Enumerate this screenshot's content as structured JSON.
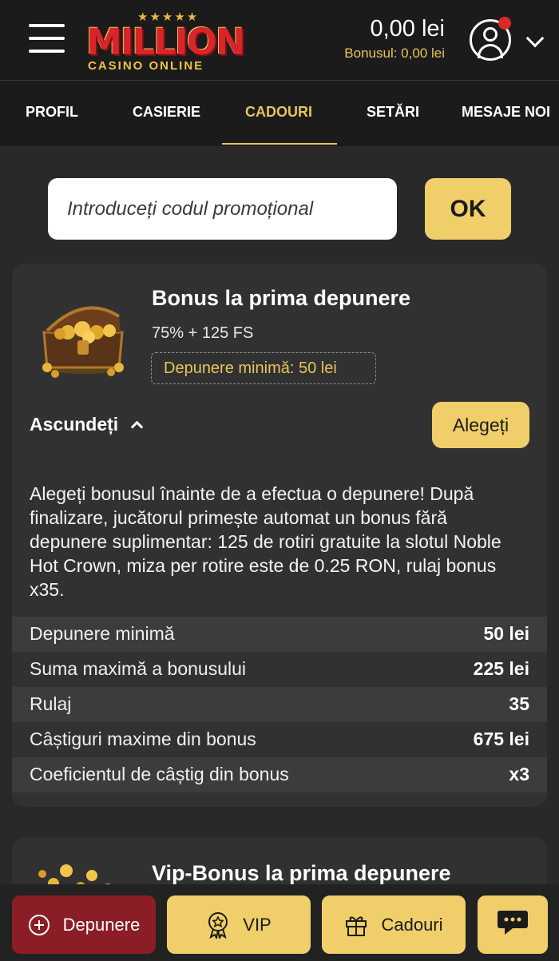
{
  "brand": {
    "logo_main": "MILLION",
    "logo_sub": "CASINO ONLINE",
    "logo_stars": "★★★★★"
  },
  "header": {
    "balance": "0,00 lei",
    "bonus_balance": "Bonusul: 0,00 lei",
    "notification_color": "#d92a2a"
  },
  "tabs": [
    {
      "label": "PROFIL"
    },
    {
      "label": "CASIERIE"
    },
    {
      "label": "CADOURI",
      "active": true
    },
    {
      "label": "SETĂRI"
    },
    {
      "label": "MESAJE NOI"
    }
  ],
  "promo": {
    "placeholder": "Introduceți codul promoțional",
    "submit_label": "OK"
  },
  "bonus_card": {
    "title": "Bonus la prima depunere",
    "subtitle": "75% + 125 FS",
    "min_deposit_badge": "Depunere minimă: 50 lei",
    "toggle_label": "Ascundeți",
    "choose_label": "Alegeți",
    "description": "Alegeți bonusul înainte de a efectua o depunere! După finalizare, jucătorul primește automat un bonus fără depunere suplimentar: 125 de rotiri gratuite la slotul Noble Hot Crown, miza per rotire este de 0.25 RON, rulaj bonus x35.",
    "details": [
      {
        "label": "Depunere minimă",
        "value": "50 lei"
      },
      {
        "label": "Suma maximă a bonusului",
        "value": "225 lei"
      },
      {
        "label": "Rulaj",
        "value": "35"
      },
      {
        "label": "Câștiguri maxime din bonus",
        "value": "675 lei"
      },
      {
        "label": "Coeficientul de câștig din bonus",
        "value": "x3"
      }
    ]
  },
  "vip_card": {
    "title": "Vip-Bonus la prima depunere"
  },
  "bottom_bar": {
    "deposit_label": "Depunere",
    "vip_label": "VIP",
    "gifts_label": "Cadouri"
  },
  "colors": {
    "accent": "#f0cf6a",
    "accent_text": "#e6c55a",
    "deposit": "#8b1d26",
    "background": "#2a2929",
    "card": "#323131"
  }
}
